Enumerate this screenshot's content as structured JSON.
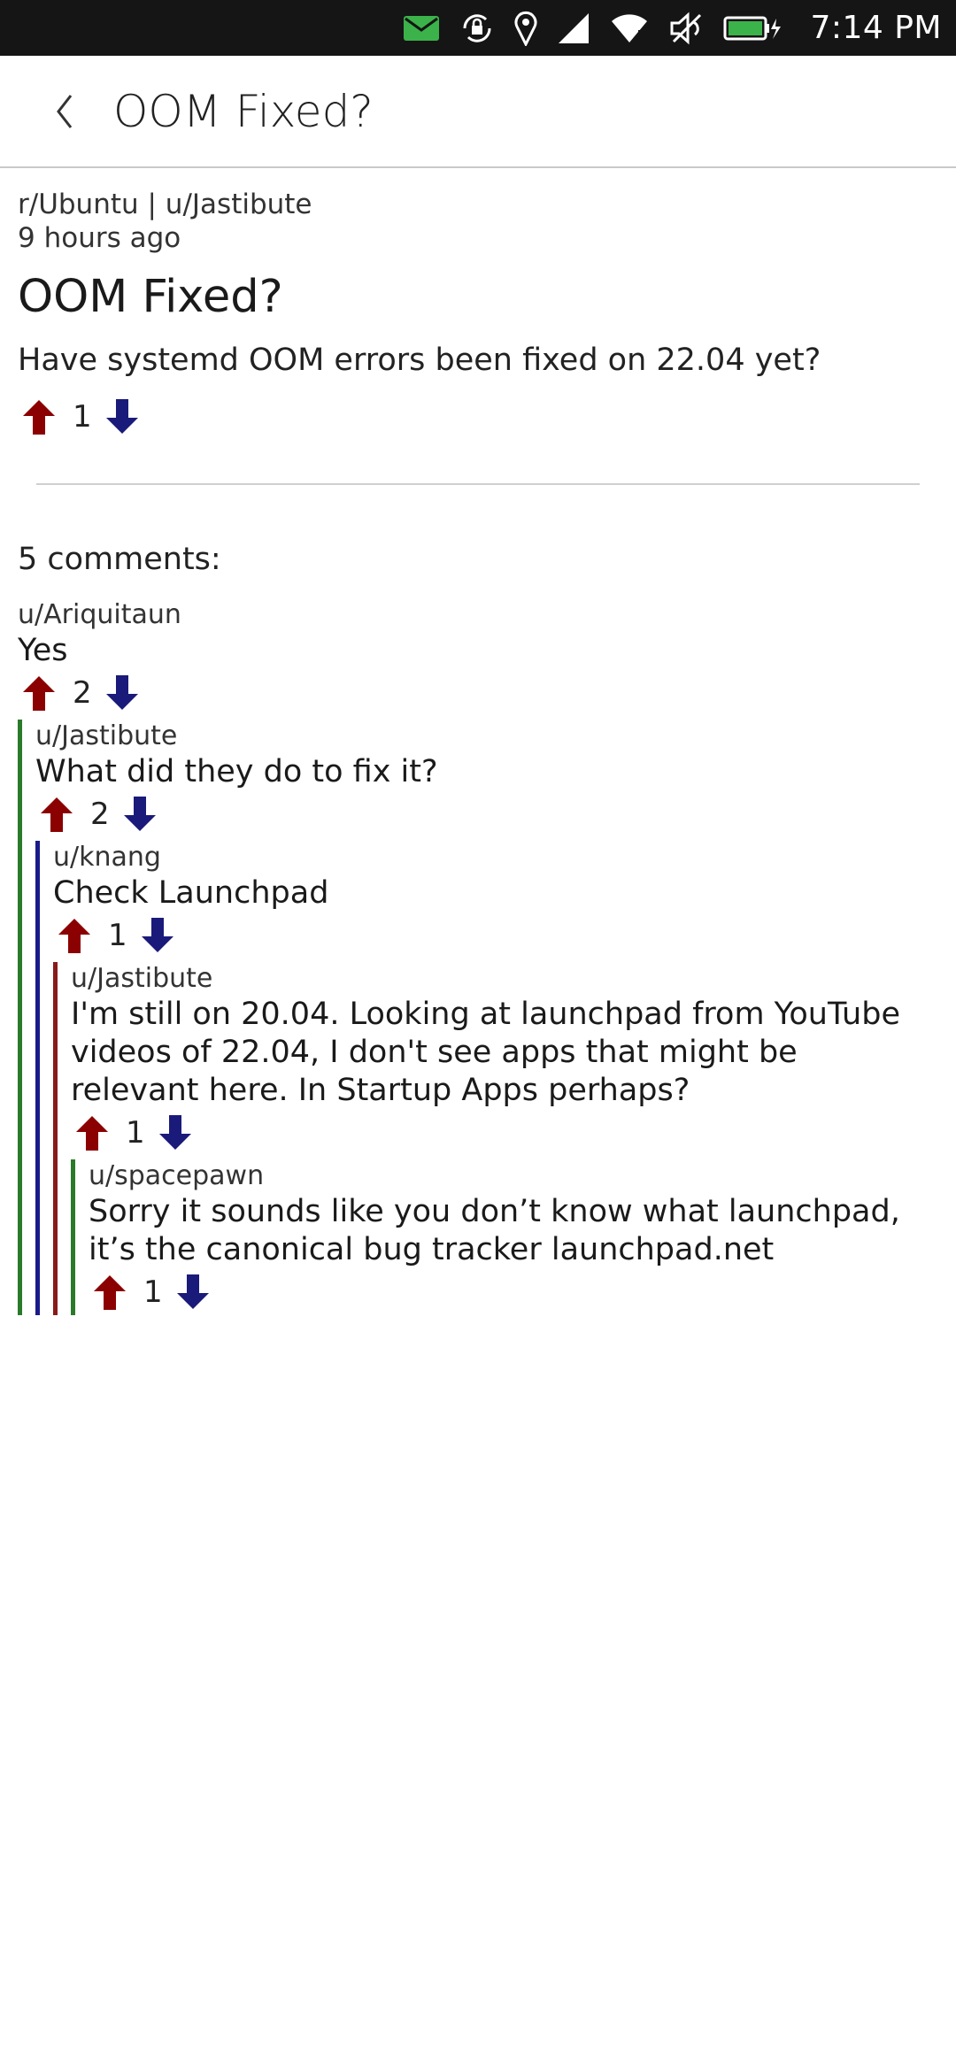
{
  "status_bar": {
    "time": "7:14 PM",
    "icons": [
      "message-icon",
      "rotation-lock-icon",
      "location-icon",
      "cellular-signal-icon",
      "wifi-icon",
      "muted-icon",
      "battery-charging-icon"
    ]
  },
  "header": {
    "title": "OOM Fixed?",
    "back_icon": "chevron-left-icon"
  },
  "post": {
    "subreddit_user": "r/Ubuntu | u/Jastibute",
    "age": "9 hours ago",
    "title": "OOM Fixed?",
    "body": "Have systemd OOM errors been fixed on 22.04 yet?",
    "score": "1"
  },
  "colors": {
    "upvote": "#8b0000",
    "downvote": "#1a1a7a",
    "thread_green": "#2a7a2a",
    "thread_blue": "#1a1a8a",
    "thread_red": "#8a1a1a"
  },
  "comments_label": "5 comments:",
  "comments": [
    {
      "author": "u/Ariquitaun",
      "body": "Yes",
      "score": "2"
    },
    {
      "author": "u/Jastibute",
      "body": "What did they do to fix it?",
      "score": "2"
    },
    {
      "author": "u/knang",
      "body": "Check Launchpad",
      "score": "1"
    },
    {
      "author": "u/Jastibute",
      "body": "I'm still on 20.04. Looking at launchpad from YouTube videos of 22.04, I don't see apps that might be relevant here. In Startup Apps perhaps?",
      "score": "1"
    },
    {
      "author": "u/spacepawn",
      "body": "Sorry it sounds like you don’t know what launchpad, it’s the canonical bug tracker launchpad.net",
      "score": "1"
    }
  ]
}
